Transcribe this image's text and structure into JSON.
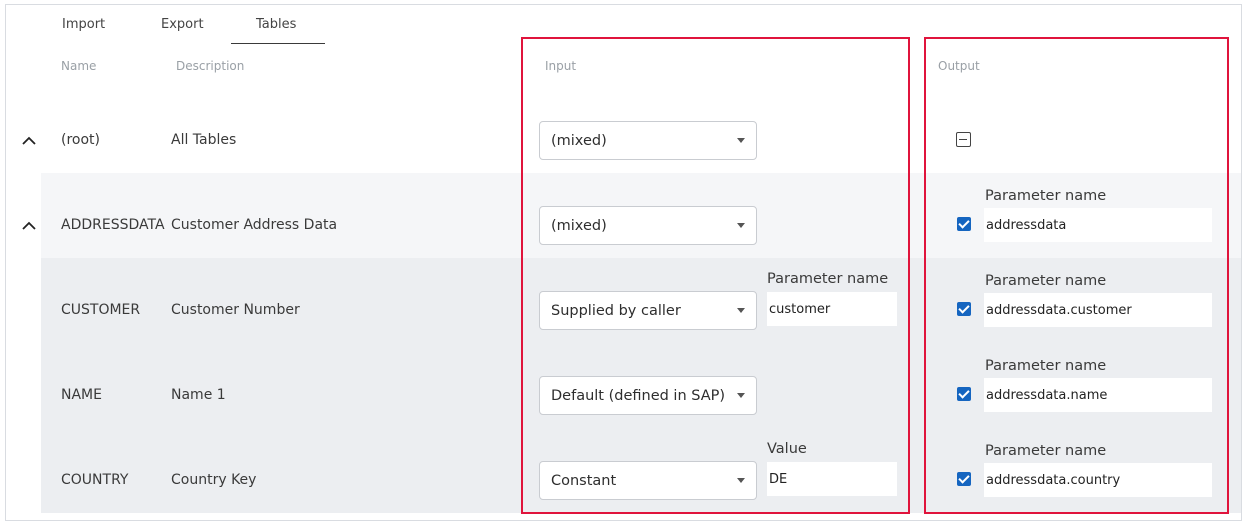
{
  "tabs": [
    {
      "label": "Import"
    },
    {
      "label": "Export"
    },
    {
      "label": "Tables",
      "active": true
    }
  ],
  "columns": {
    "name": "Name",
    "description": "Description",
    "input": "Input",
    "output": "Output"
  },
  "rows": [
    {
      "name": "(root)",
      "description": "All Tables",
      "input": "(mixed)",
      "output_state": "indeterminate",
      "expanded": true
    },
    {
      "name": "ADDRESSDATA",
      "description": "Customer Address Data",
      "input": "(mixed)",
      "output_label": "Parameter name",
      "output_value": "addressdata",
      "checked": true,
      "expanded": true
    },
    {
      "name": "CUSTOMER",
      "description": "Customer Number",
      "input": "Supplied by caller",
      "input_label": "Parameter name",
      "input_value": "customer",
      "output_label": "Parameter name",
      "output_value": "addressdata.customer",
      "checked": true
    },
    {
      "name": "NAME",
      "description": "Name 1",
      "input": "Default (defined in SAP)",
      "output_label": "Parameter name",
      "output_value": "addressdata.name",
      "checked": true
    },
    {
      "name": "COUNTRY",
      "description": "Country Key",
      "input": "Constant",
      "input_label": "Value",
      "input_value": "DE",
      "output_label": "Parameter name",
      "output_value": "addressdata.country",
      "checked": true
    }
  ],
  "colors": {
    "highlight": "#e0143c",
    "checkbox": "#1565c0",
    "row_alt": "#eceef1"
  },
  "icons": {
    "collapse": "chevron-up-icon",
    "dropdown": "caret-down-icon",
    "checked": "checkbox-checked-icon",
    "indeterminate": "checkbox-indeterminate-icon"
  }
}
